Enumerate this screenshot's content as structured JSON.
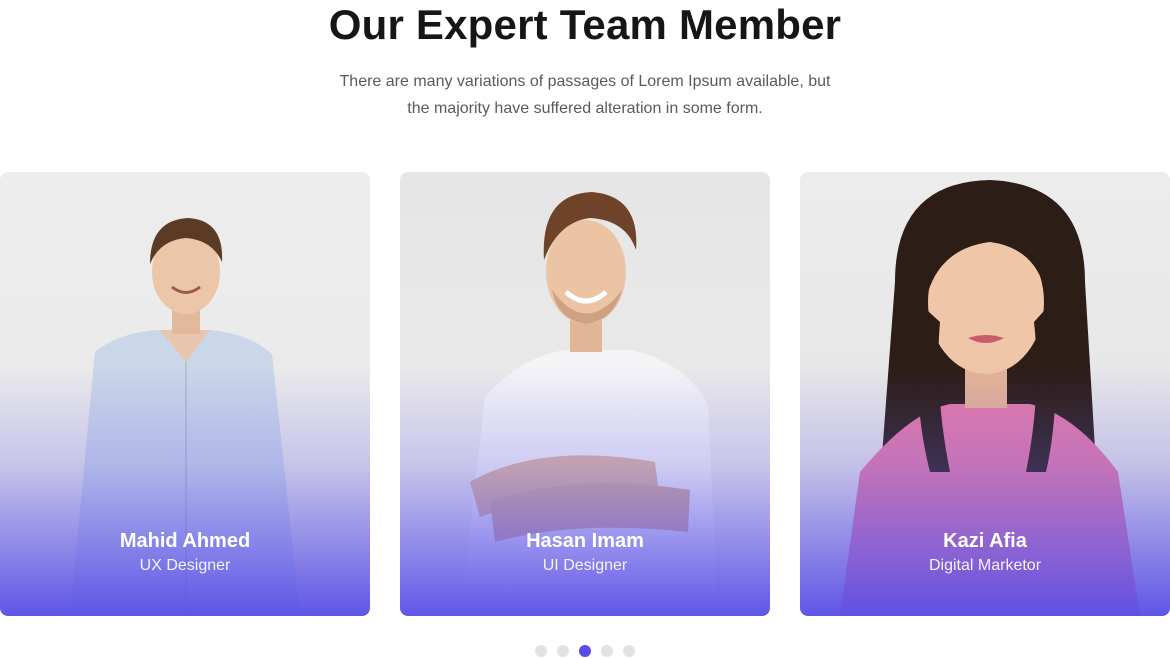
{
  "section": {
    "title": "Our Expert Team Member",
    "subtitle_line1": "There are many variations of passages of Lorem Ipsum available, but",
    "subtitle_line2": "the majority have suffered alteration in some form."
  },
  "members": [
    {
      "name": "Mahid Ahmed",
      "role": "UX Designer"
    },
    {
      "name": "Hasan Imam",
      "role": "UI Designer"
    },
    {
      "name": "Kazi Afia",
      "role": "Digital Marketor"
    }
  ],
  "pagination": {
    "total": 5,
    "active_index": 3
  },
  "colors": {
    "accent": "#5a4ee6",
    "overlay": "#6b61eb",
    "inactive_dot": "#e2e2e2",
    "title": "#161616",
    "subtitle": "#5a5a5a"
  }
}
